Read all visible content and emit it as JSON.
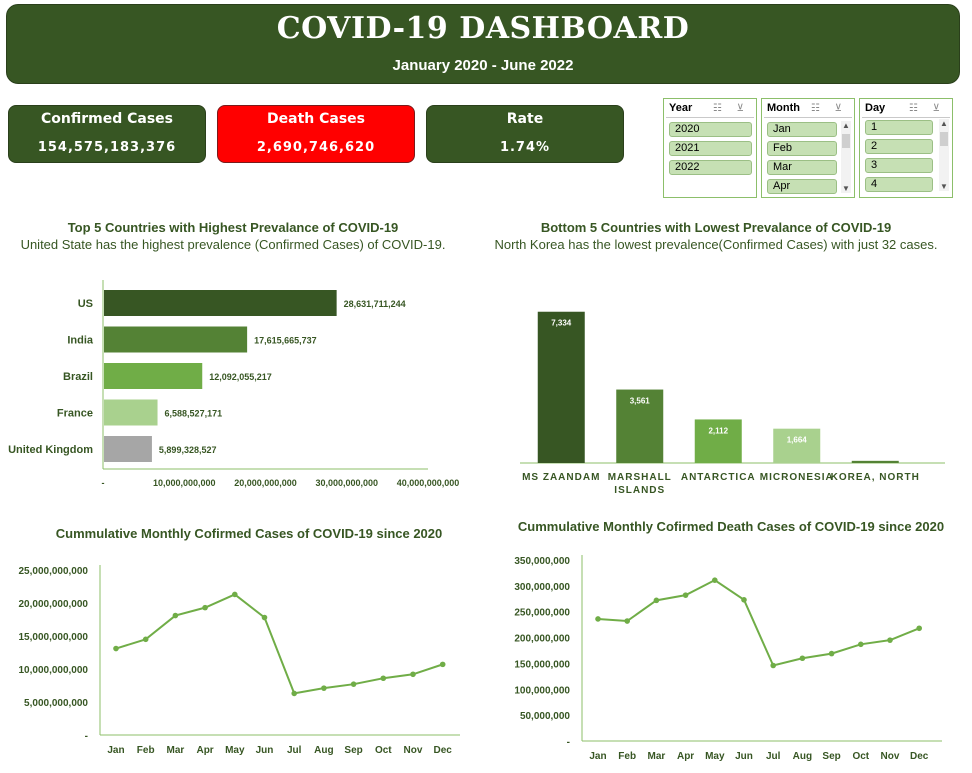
{
  "header": {
    "title": "COVID-19 DASHBOARD",
    "subtitle": "January 2020 - June 2022"
  },
  "kpis": [
    {
      "label": "Confirmed Cases",
      "value": "154,575,183,376"
    },
    {
      "label": "Death Cases",
      "value": "2,690,746,620"
    },
    {
      "label": "Rate",
      "value": "1.74%"
    }
  ],
  "colors": {
    "dark_green": "#375623",
    "red": "#ff0000",
    "line_green": "#70ad47"
  },
  "slicers": {
    "year": {
      "label": "Year",
      "items": [
        "2020",
        "2021",
        "2022"
      ]
    },
    "month": {
      "label": "Month",
      "items": [
        "Jan",
        "Feb",
        "Mar",
        "Apr"
      ]
    },
    "day": {
      "label": "Day",
      "items": [
        "1",
        "2",
        "3",
        "4"
      ]
    }
  },
  "chart_data": [
    {
      "type": "bar",
      "orientation": "horizontal",
      "title": "Top 5 Countries with Highest Prevalance of COVID-19",
      "subtitle": "United State has the highest prevalence  (Confirmed Cases) of COVID-19.",
      "categories": [
        "US",
        "India",
        "Brazil",
        "France",
        "United Kingdom"
      ],
      "values": [
        28631711244,
        17615665737,
        12092055217,
        6588527171,
        5899328527
      ],
      "value_labels": [
        "28,631,711,244",
        "17,615,665,737",
        "12,092,055,217",
        "6,588,527,171",
        "5,899,328,527"
      ],
      "bar_colors": [
        "#375623",
        "#548235",
        "#70ad47",
        "#a9d18e",
        "#a6a6a6"
      ],
      "xlim": [
        0,
        40000000000
      ],
      "x_ticks": [
        "-",
        "10,000,000,000",
        "20,000,000,000",
        "30,000,000,000",
        "40,000,000,000"
      ]
    },
    {
      "type": "bar",
      "orientation": "vertical",
      "title": "Bottom 5 Countries with Lowest Prevalance of COVID-19",
      "subtitle": "North Korea has the lowest prevalence(Confirmed Cases) with just 32 cases.",
      "categories": [
        "MS ZAANDAM",
        "MARSHALL ISLANDS",
        "ANTARCTICA",
        "MICRONESIA",
        "KOREA, NORTH"
      ],
      "values": [
        7334,
        3561,
        2112,
        1664,
        32
      ],
      "value_labels": [
        "7,334",
        "3,561",
        "2,112",
        "1,664",
        ""
      ],
      "bar_colors": [
        "#375623",
        "#548235",
        "#70ad47",
        "#a9d18e",
        "#548235"
      ],
      "ylim": [
        0,
        8000
      ]
    },
    {
      "type": "line",
      "title": "Cummulative Monthly Cofirmed Cases of COVID-19 since 2020",
      "categories": [
        "Jan",
        "Feb",
        "Mar",
        "Apr",
        "May",
        "Jun",
        "Jul",
        "Aug",
        "Sep",
        "Oct",
        "Nov",
        "Dec"
      ],
      "values": [
        13100000000,
        14500000000,
        18100000000,
        19300000000,
        21300000000,
        17800000000,
        6300000000,
        7100000000,
        7700000000,
        8600000000,
        9200000000,
        10700000000
      ],
      "ylim": [
        0,
        25000000000
      ],
      "y_ticks": [
        "-",
        "5,000,000,000",
        "10,000,000,000",
        "15,000,000,000",
        "20,000,000,000",
        "25,000,000,000"
      ]
    },
    {
      "type": "line",
      "title": "Cummulative Monthly Cofirmed Death Cases of COVID-19 since 2020",
      "categories": [
        "Jan",
        "Feb",
        "Mar",
        "Apr",
        "May",
        "Jun",
        "Jul",
        "Aug",
        "Sep",
        "Oct",
        "Nov",
        "Dec"
      ],
      "values": [
        236000000,
        232000000,
        272000000,
        282000000,
        311000000,
        273000000,
        146000000,
        160000000,
        169000000,
        187000000,
        195000000,
        218000000
      ],
      "ylim": [
        0,
        350000000
      ],
      "y_ticks": [
        "-",
        "50,000,000",
        "100,000,000",
        "150,000,000",
        "200,000,000",
        "250,000,000",
        "300,000,000",
        "350,000,000"
      ]
    }
  ]
}
